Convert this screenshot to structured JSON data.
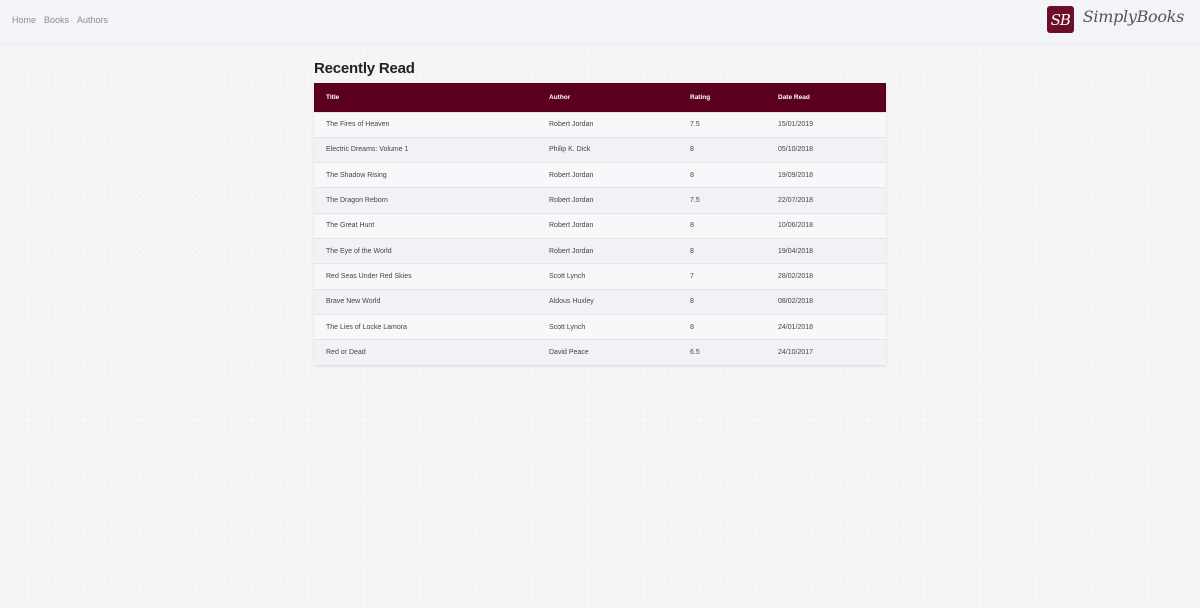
{
  "nav": {
    "links": [
      "Home",
      "Books",
      "Authors"
    ],
    "brand_logo_text": "SB",
    "brand_name": "SimplyBooks"
  },
  "main": {
    "title": "Recently Read",
    "table": {
      "headers": [
        "Title",
        "Author",
        "Rating",
        "Date Read"
      ],
      "rows": [
        [
          "The Fires of Heaven",
          "Robert Jordan",
          "7.5",
          "15/01/2019"
        ],
        [
          "Electric Dreams: Volume 1",
          "Philip K. Dick",
          "8",
          "05/10/2018"
        ],
        [
          "The Shadow Rising",
          "Robert Jordan",
          "8",
          "19/09/2018"
        ],
        [
          "The Dragon Reborn",
          "Robert Jordan",
          "7.5",
          "22/07/2018"
        ],
        [
          "The Great Hunt",
          "Robert Jordan",
          "8",
          "10/06/2018"
        ],
        [
          "The Eye of the World",
          "Robert Jordan",
          "8",
          "19/04/2018"
        ],
        [
          "Red Seas Under Red Skies",
          "Scott Lynch",
          "7",
          "28/02/2018"
        ],
        [
          "Brave New World",
          "Aldous Huxley",
          "8",
          "08/02/2018"
        ],
        [
          "The Lies of Locke Lamora",
          "Scott Lynch",
          "8",
          "24/01/2018"
        ],
        [
          "Red or Dead",
          "David Peace",
          "6.5",
          "24/10/2017"
        ]
      ]
    }
  },
  "colors": {
    "accent": "#5b0020",
    "logo": "#6c0d2a"
  }
}
